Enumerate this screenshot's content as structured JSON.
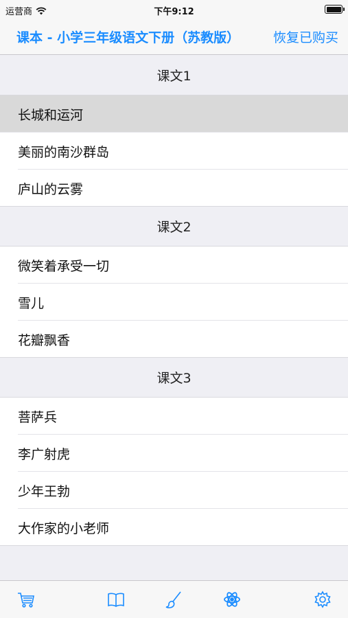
{
  "status_bar": {
    "carrier": "运营商",
    "time": "下午9:12"
  },
  "nav": {
    "title": "课本 - 小学三年级语文下册（苏教版）",
    "restore_label": "恢复已购买"
  },
  "sections": [
    {
      "header": "课文1",
      "items": [
        "长城和运河",
        "美丽的南沙群岛",
        "庐山的云雾"
      ]
    },
    {
      "header": "课文2",
      "items": [
        "微笑着承受一切",
        "雪儿",
        "花瓣飘香"
      ]
    },
    {
      "header": "课文3",
      "items": [
        "菩萨兵",
        "李广射虎",
        "少年王勃",
        "大作家的小老师"
      ]
    }
  ],
  "tabs": [
    {
      "icon": "cart-icon"
    },
    {
      "icon": "book-icon"
    },
    {
      "icon": "brush-icon"
    },
    {
      "icon": "atom-icon"
    },
    {
      "icon": "gear-icon"
    }
  ],
  "colors": {
    "accent": "#1a8cff",
    "selected_row": "#d9d9d9",
    "background": "#efeff4"
  }
}
